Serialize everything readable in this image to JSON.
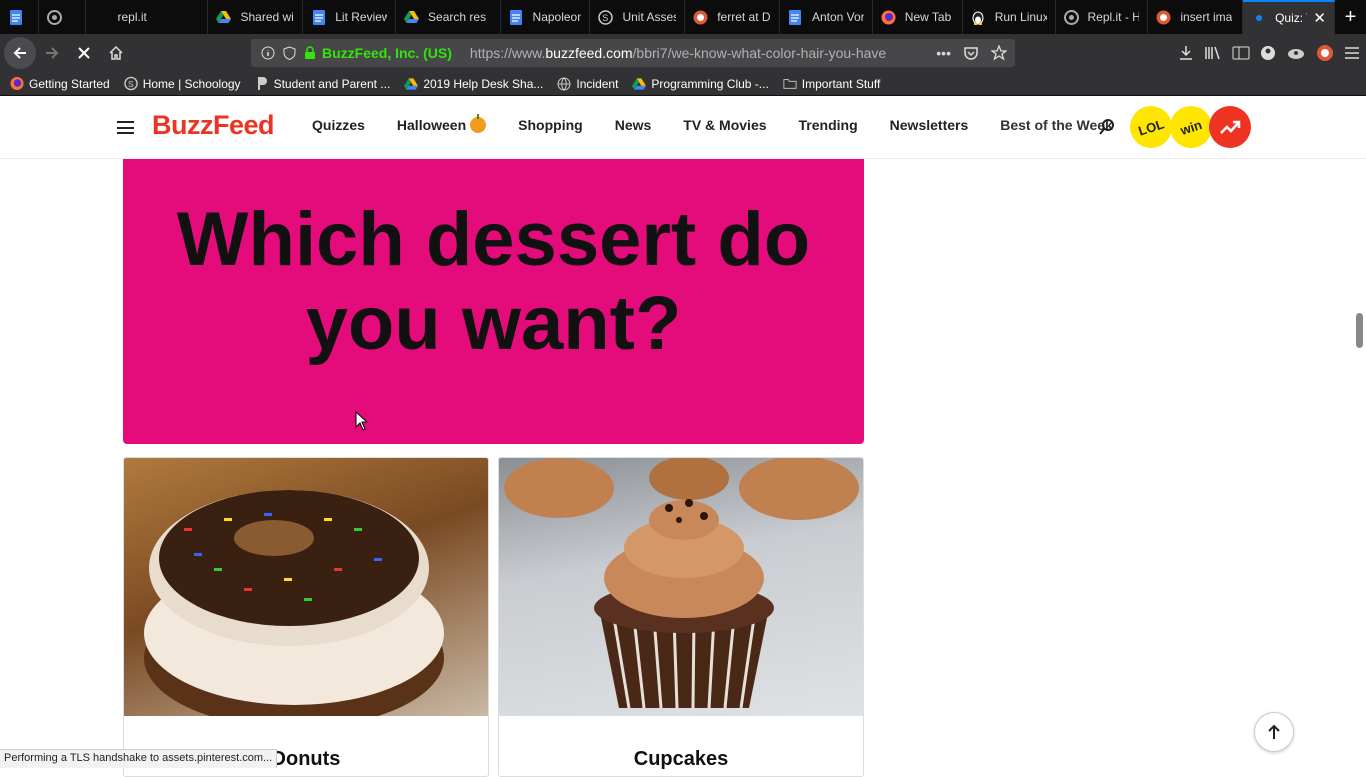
{
  "browser": {
    "tabs": [
      {
        "title": "",
        "icon": "docs-icon"
      },
      {
        "title": "",
        "icon": "replit-icon"
      },
      {
        "title": "repl.it",
        "icon": "blank-icon"
      },
      {
        "title": "Shared wi",
        "icon": "drive-icon"
      },
      {
        "title": "Lit Review",
        "icon": "docs-icon"
      },
      {
        "title": "Search res",
        "icon": "drive-icon"
      },
      {
        "title": "Napoleon",
        "icon": "docs-icon"
      },
      {
        "title": "Unit Asses",
        "icon": "schoology-icon"
      },
      {
        "title": "ferret at D",
        "icon": "duckduckgo-icon"
      },
      {
        "title": "Anton Vor",
        "icon": "docs-icon"
      },
      {
        "title": "New Tab",
        "icon": "firefox-icon"
      },
      {
        "title": "Run Linux",
        "icon": "linux-icon"
      },
      {
        "title": "Repl.it - H",
        "icon": "replit-icon"
      },
      {
        "title": "insert ima",
        "icon": "duckduckgo-icon"
      },
      {
        "title": "Quiz: W",
        "icon": "loading-dot-icon",
        "active": true
      }
    ],
    "identity": "BuzzFeed, Inc. (US)",
    "url_prefix": "https://www.",
    "url_domain": "buzzfeed.com",
    "url_path": "/bbri7/we-know-what-color-hair-you-have",
    "bookmarks": [
      {
        "label": "Getting Started",
        "icon": "firefox-icon"
      },
      {
        "label": "Home | Schoology",
        "icon": "schoology-icon"
      },
      {
        "label": "Student and Parent ...",
        "icon": "pearson-icon"
      },
      {
        "label": "2019 Help Desk Sha...",
        "icon": "drive-icon"
      },
      {
        "label": "Incident",
        "icon": "globe-icon"
      },
      {
        "label": "Programming Club -...",
        "icon": "drive-icon"
      },
      {
        "label": "Important Stuff",
        "icon": "folder-icon"
      }
    ],
    "status_text": "Performing a TLS handshake to assets.pinterest.com..."
  },
  "site": {
    "logo": "BuzzFeed",
    "nav": [
      "Quizzes",
      "Halloween",
      "Shopping",
      "News",
      "TV & Movies",
      "Trending",
      "Newsletters",
      "Best of the Week"
    ],
    "badges": {
      "lol": "LOL",
      "win": "win"
    },
    "colors": {
      "brand_red": "#ee3322",
      "hero_pink": "#e40c7b",
      "badge_yellow": "#ffe600"
    }
  },
  "quiz": {
    "question": "Which dessert do you want?",
    "answers": [
      {
        "label": "Donuts",
        "image": "sprinkled-donuts-photo"
      },
      {
        "label": "Cupcakes",
        "image": "chocolate-cupcakes-photo"
      }
    ]
  }
}
